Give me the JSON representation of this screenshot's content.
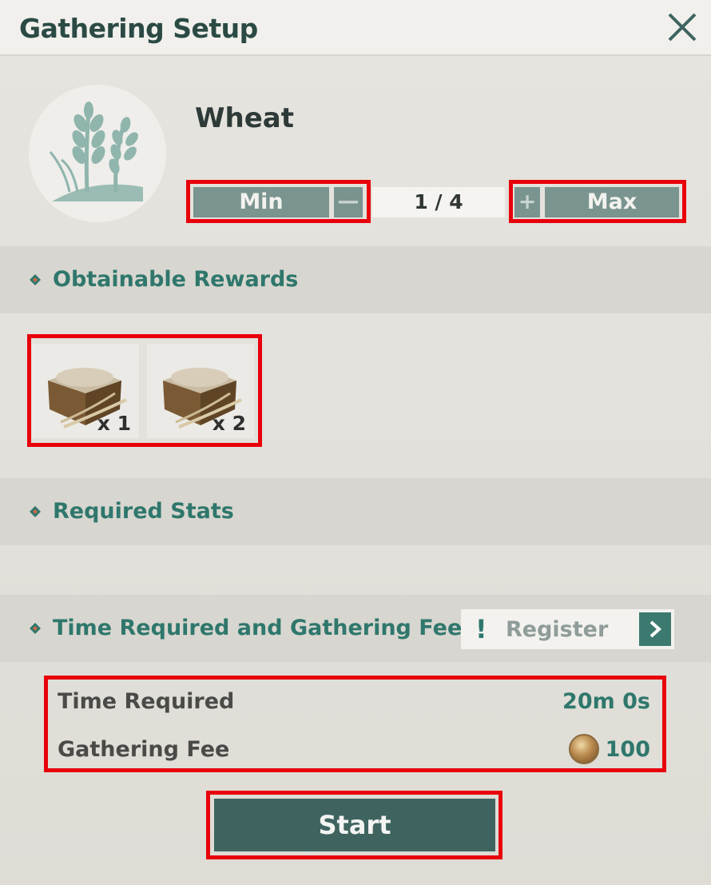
{
  "header": {
    "title": "Gathering Setup",
    "close_icon": "close-icon"
  },
  "item": {
    "name": "Wheat",
    "icon": "wheat-icon"
  },
  "quantity": {
    "min_label": "Min",
    "max_label": "Max",
    "minus_glyph": "—",
    "plus_glyph": "+",
    "value": "1 / 4"
  },
  "sections": {
    "rewards_title": "Obtainable Rewards",
    "stats_title": "Required Stats",
    "time_fee_title": "Time Required and Gathering Fee"
  },
  "rewards": [
    {
      "icon": "grain-crate-icon",
      "count": "x 1"
    },
    {
      "icon": "grain-crate-icon",
      "count": "x 2"
    }
  ],
  "register": {
    "label": "Register",
    "alert_glyph": "!",
    "arrow_icon": "chevron-right-icon"
  },
  "info": {
    "time_label": "Time Required",
    "time_value": "20m 0s",
    "fee_label": "Gathering Fee",
    "fee_value": "100",
    "fee_icon": "coin-icon"
  },
  "start_label": "Start",
  "colors": {
    "accent": "#2f776c",
    "button_dark": "#3f6460",
    "button_grey": "#7a948f",
    "highlight_outline": "#e8000b"
  }
}
